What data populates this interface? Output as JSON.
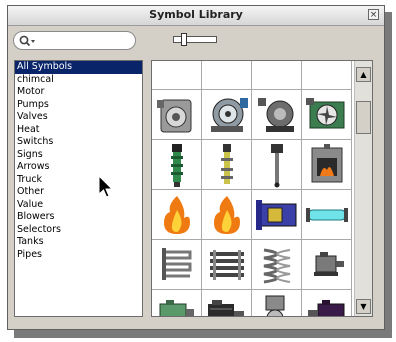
{
  "window": {
    "title": "Symbol Library",
    "close_glyph": "×"
  },
  "search": {
    "placeholder": "",
    "value": "",
    "icon": "search-icon"
  },
  "zoom_slider": {
    "level": 0.2
  },
  "categories": [
    "All Symbols",
    "chimcal",
    "Motor",
    "Pumps",
    "Valves",
    "Heat",
    "Switchs",
    "Signs",
    "Arrows",
    "Truck",
    "Other",
    "Value",
    "Blowers",
    "Selectors",
    "Tanks",
    "Pipes"
  ],
  "selected_category": "All Symbols",
  "symbols": [
    "partial-symbol",
    "partial-motor",
    "partial-wheel",
    "partial-pipe",
    "centrifugal-blower",
    "turbo-blower",
    "drum-blower",
    "fan-blower",
    "green-heat-rod",
    "yellow-heat-rod",
    "thermocouple-probe",
    "furnace",
    "flame",
    "flame",
    "heat-panel",
    "cyan-tube",
    "coil-radiator",
    "finned-heater",
    "spiral-coil",
    "small-motor",
    "green-motor",
    "black-motor",
    "pump-valve",
    "purple-motor"
  ],
  "scrollbar": {
    "up": "▲",
    "down": "▼"
  }
}
